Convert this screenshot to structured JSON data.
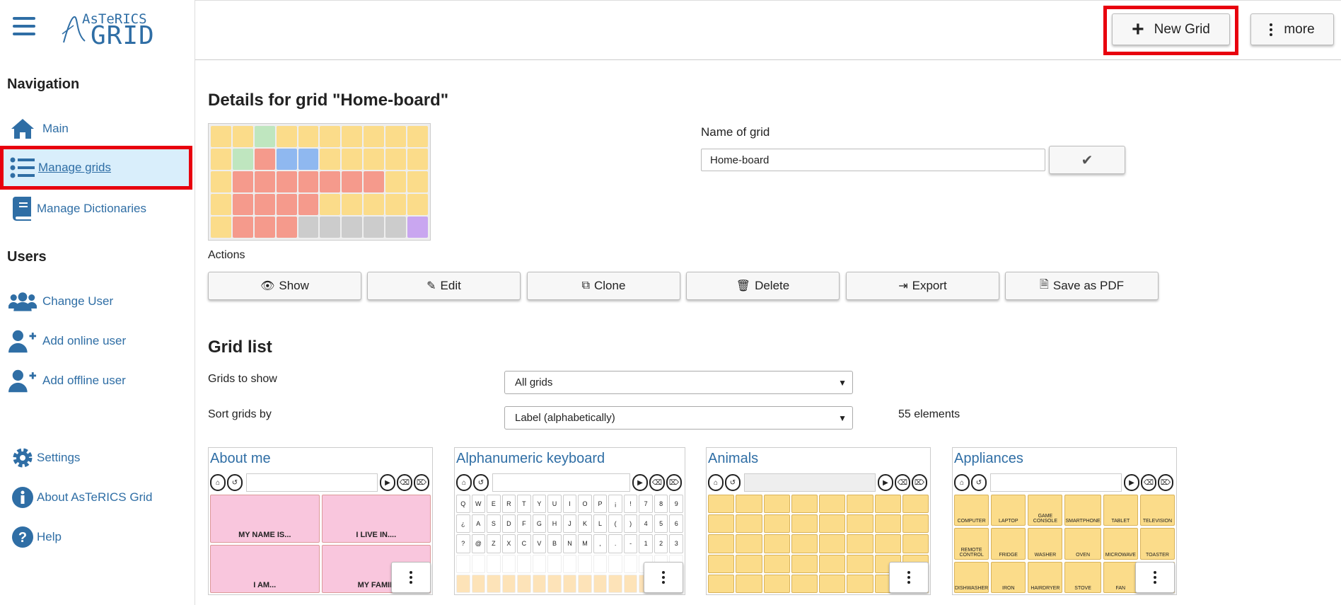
{
  "app": {
    "logo_top": "AsTeRICS",
    "logo_bottom": "GRID"
  },
  "sidebar": {
    "navigation_title": "Navigation",
    "nav_items": [
      {
        "label": "Main",
        "icon": "home-icon"
      },
      {
        "label": "Manage grids",
        "icon": "list-icon",
        "active": true
      },
      {
        "label": "Manage Dictionaries",
        "icon": "book-icon"
      }
    ],
    "users_title": "Users",
    "user_items": [
      {
        "label": "Change User",
        "icon": "users-icon"
      },
      {
        "label": "Add online user",
        "icon": "user-plus-icon"
      },
      {
        "label": "Add offline user",
        "icon": "user-plus-icon"
      }
    ],
    "bottom_items": [
      {
        "label": "Settings",
        "icon": "gear-icon"
      },
      {
        "label": "About AsTeRICS Grid",
        "icon": "info-icon"
      },
      {
        "label": "Help",
        "icon": "question-icon"
      }
    ]
  },
  "header": {
    "new_grid_label": "New Grid",
    "more_label": "more"
  },
  "details": {
    "title": "Details for grid \"Home-board\"",
    "name_label": "Name of grid",
    "name_value": "Home-board",
    "actions_label": "Actions",
    "actions": [
      "Show",
      "Edit",
      "Clone",
      "Delete",
      "Export",
      "Save as PDF"
    ]
  },
  "grid_list": {
    "title": "Grid list",
    "show_label": "Grids to show",
    "show_value": "All grids",
    "sort_label": "Sort grids by",
    "sort_value": "Label (alphabetically)",
    "count_text": "55 elements",
    "cards": [
      {
        "title": "About me",
        "cells": [
          "MY NAME IS...",
          "I LIVE IN....",
          "I AM...",
          "MY FAMIL"
        ]
      },
      {
        "title": "Alphanumeric keyboard",
        "keys": [
          "Q",
          "W",
          "E",
          "R",
          "T",
          "Y",
          "U",
          "I",
          "O",
          "P",
          "¡",
          "!",
          "7",
          "8",
          "9",
          "¿",
          "A",
          "S",
          "D",
          "F",
          "G",
          "H",
          "J",
          "K",
          "L",
          "(",
          ")",
          "4",
          "5",
          "6",
          "?",
          "@",
          "Z",
          "X",
          "C",
          "V",
          "B",
          "N",
          "M",
          ",",
          ".",
          "-",
          "1",
          "2",
          "3"
        ]
      },
      {
        "title": "Animals"
      },
      {
        "title": "Appliances",
        "cells": [
          "COMPUTER",
          "LAPTOP",
          "GAME CONSOLE",
          "SMARTPHONE",
          "TABLET",
          "TELEVISION",
          "REMOTE CONTROL",
          "FRIDGE",
          "WASHER",
          "OVEN",
          "MICROWAVE",
          "TOASTER",
          "DISHWASHER",
          "IRON",
          "HAIRDRYER",
          "STOVE",
          "FAN",
          ""
        ]
      }
    ]
  },
  "colors": {
    "accent": "#2f6ea5",
    "highlight": "#e8000e",
    "active_bg": "#d9eefb",
    "pink_cell": "#f9c6dd",
    "yellow_cell": "#fbdc8a"
  }
}
